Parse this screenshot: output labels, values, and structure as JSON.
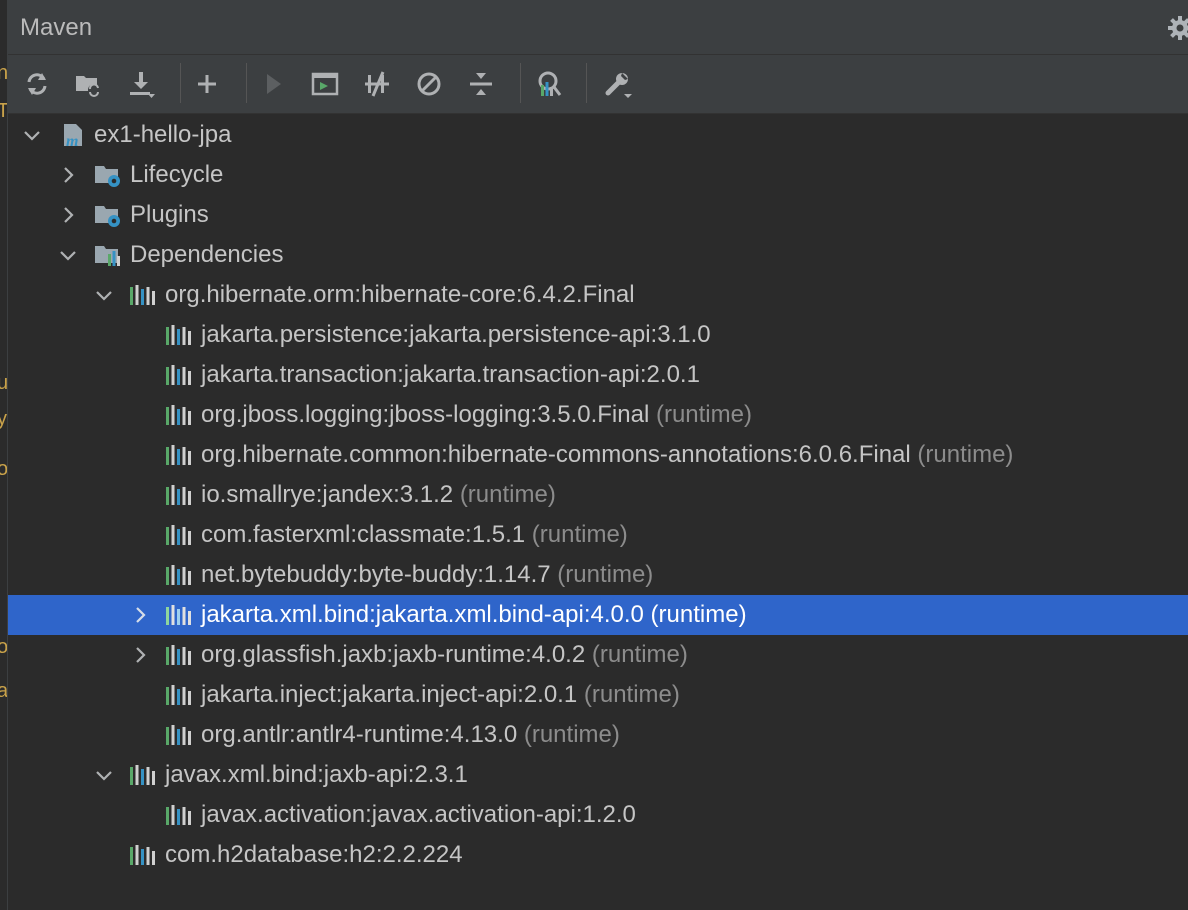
{
  "window": {
    "title": "Maven"
  },
  "toolbar": {
    "buttons": [
      {
        "name": "reload-all-icon"
      },
      {
        "name": "generate-sources-icon"
      },
      {
        "name": "download-sources-icon"
      },
      {
        "name": "add-maven-project-icon"
      },
      {
        "name": "run-maven-build-icon"
      },
      {
        "name": "execute-maven-goal-icon"
      },
      {
        "name": "toggle-offline-mode-icon"
      },
      {
        "name": "skip-tests-icon"
      },
      {
        "name": "collapse-all-icon"
      },
      {
        "name": "show-dependencies-icon"
      },
      {
        "name": "build-tool-settings-icon"
      }
    ]
  },
  "tree": {
    "project": "ex1-hello-jpa",
    "lifecycle": "Lifecycle",
    "plugins": "Plugins",
    "dependencies": "Dependencies",
    "deps": [
      {
        "label": "org.hibernate.orm:hibernate-core:6.4.2.Final",
        "scope": ""
      },
      {
        "label": "jakarta.persistence:jakarta.persistence-api:3.1.0",
        "scope": ""
      },
      {
        "label": "jakarta.transaction:jakarta.transaction-api:2.0.1",
        "scope": ""
      },
      {
        "label": "org.jboss.logging:jboss-logging:3.5.0.Final",
        "scope": "(runtime)"
      },
      {
        "label": "org.hibernate.common:hibernate-commons-annotations:6.0.6.Final",
        "scope": "(runtime)"
      },
      {
        "label": "io.smallrye:jandex:3.1.2",
        "scope": "(runtime)"
      },
      {
        "label": "com.fasterxml:classmate:1.5.1",
        "scope": "(runtime)"
      },
      {
        "label": "net.bytebuddy:byte-buddy:1.14.7",
        "scope": "(runtime)"
      },
      {
        "label": "jakarta.xml.bind:jakarta.xml.bind-api:4.0.0",
        "scope": "(runtime)"
      },
      {
        "label": "org.glassfish.jaxb:jaxb-runtime:4.0.2",
        "scope": "(runtime)"
      },
      {
        "label": "jakarta.inject:jakarta.inject-api:2.0.1",
        "scope": "(runtime)"
      },
      {
        "label": "org.antlr:antlr4-runtime:4.13.0",
        "scope": "(runtime)"
      },
      {
        "label": "javax.xml.bind:jaxb-api:2.3.1",
        "scope": ""
      },
      {
        "label": "javax.activation:javax.activation-api:1.2.0",
        "scope": ""
      },
      {
        "label": "com.h2database:h2:2.2.224",
        "scope": ""
      }
    ]
  },
  "colors": {
    "selection": "#2f65ca",
    "background": "#2b2b2b",
    "header": "#3c3f41"
  }
}
